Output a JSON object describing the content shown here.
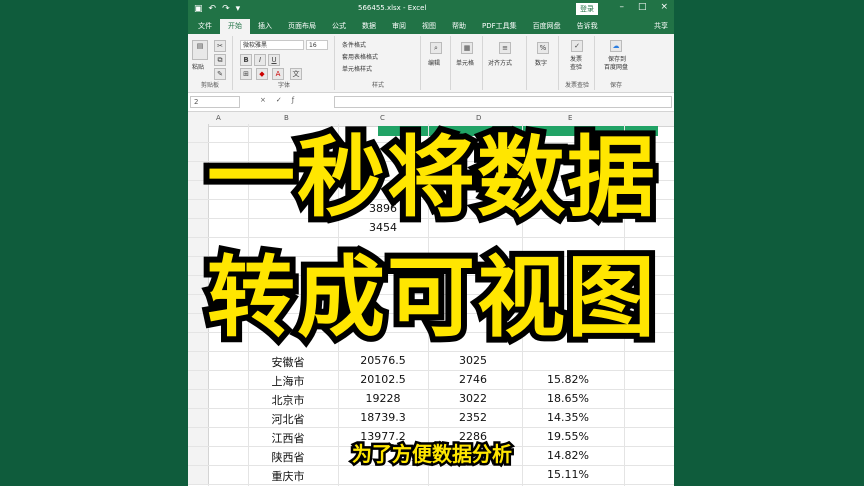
{
  "window": {
    "filename": "566455.xlsx  -  Excel",
    "login": "登录",
    "tabs": [
      "文件",
      "开始",
      "插入",
      "页面布局",
      "公式",
      "数据",
      "审阅",
      "视图",
      "帮助",
      "PDF工具集",
      "百度网盘",
      "告诉我"
    ],
    "share": "共享"
  },
  "ribbon": {
    "paste": "粘贴",
    "clipboard": "剪贴板",
    "font_name": "微软雅黑",
    "font_size": "16",
    "font_group": "字体",
    "style_items": [
      "条件格式",
      "套用表格格式",
      "单元格样式"
    ],
    "style_group": "样式",
    "edit": "编辑",
    "cells": "单元格",
    "align": "对齐方式",
    "number": "数字",
    "invoice": [
      "发票",
      "查验"
    ],
    "invoice_group": "发票查验",
    "save": [
      "保存到",
      "百度网盘"
    ],
    "save_group": "保存"
  },
  "formula_bar": {
    "name_box": "2",
    "value": ""
  },
  "columns": [
    "A",
    "B",
    "C",
    "D",
    "E"
  ],
  "rows": [
    {
      "c1": "",
      "c2": "",
      "c3": "",
      "c4": ""
    },
    {
      "c1": "",
      "c2": "",
      "c3": "",
      "c4": ""
    },
    {
      "c1": "",
      "c2": "",
      "c3": "",
      "c4": ""
    },
    {
      "c1": "",
      "c2": "",
      "c3": "",
      "c4": ""
    },
    {
      "c1": "",
      "c2": "3896",
      "c3": "",
      "c4": ""
    },
    {
      "c1": "",
      "c2": "3454",
      "c3": "",
      "c4": ""
    },
    {
      "c1": "",
      "c2": "",
      "c3": "",
      "c4": ""
    },
    {
      "c1": "",
      "c2": "",
      "c3": "",
      "c4": ""
    },
    {
      "c1": "",
      "c2": "",
      "c3": "",
      "c4": ""
    },
    {
      "c1": "",
      "c2": "",
      "c3": "",
      "c4": ""
    },
    {
      "c1": "",
      "c2": "",
      "c3": "",
      "c4": ""
    },
    {
      "c1": "",
      "c2": "",
      "c3": "",
      "c4": ""
    },
    {
      "c1": "安徽省",
      "c2": "20576.5",
      "c3": "3025",
      "c4": ""
    },
    {
      "c1": "上海市",
      "c2": "20102.5",
      "c3": "2746",
      "c4": "15.82%"
    },
    {
      "c1": "北京市",
      "c2": "19228",
      "c3": "3022",
      "c4": "18.65%"
    },
    {
      "c1": "河北省",
      "c2": "18739.3",
      "c3": "2352",
      "c4": "14.35%"
    },
    {
      "c1": "江西省",
      "c2": "13977.2",
      "c3": "2286",
      "c4": "19.55%"
    },
    {
      "c1": "陕西省",
      "c2": "",
      "c3": "",
      "c4": "14.82%"
    },
    {
      "c1": "重庆市",
      "c2": "",
      "c3": "",
      "c4": "15.11%"
    }
  ],
  "overlay": {
    "line1": "一秒将数据",
    "line2": "转成可视图",
    "subtitle": "为了方便数据分析"
  },
  "colors": {
    "excel_green": "#217346",
    "background": "#0f5c3c",
    "caption": "#ffe600"
  }
}
